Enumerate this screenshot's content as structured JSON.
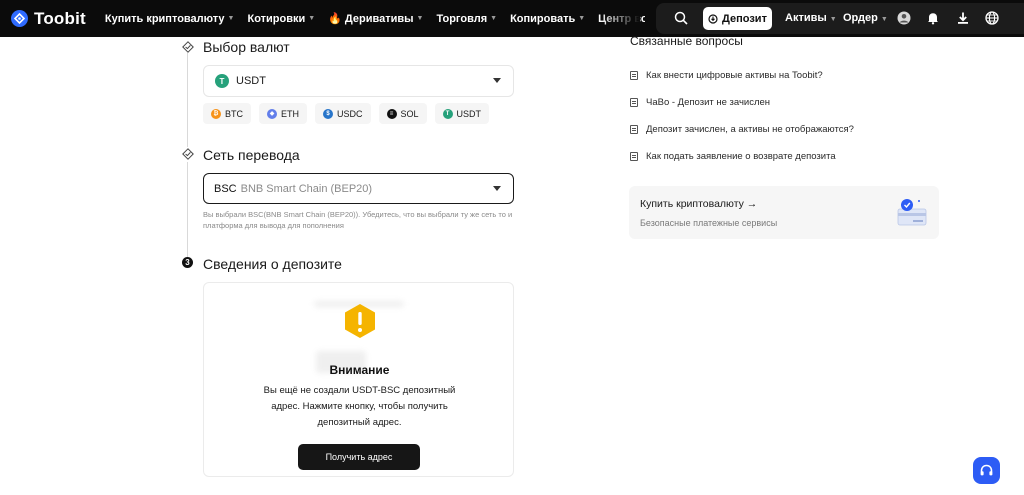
{
  "header": {
    "brand": "Toobit",
    "nav": [
      {
        "label": "Купить криптовалюту",
        "caret": true
      },
      {
        "label": "Котировки",
        "caret": true
      },
      {
        "label": "Деривативы",
        "caret": true,
        "hot": true
      },
      {
        "label": "Торговля",
        "caret": true
      },
      {
        "label": "Копировать",
        "caret": true
      },
      {
        "label": "Центр вознаграждений",
        "caret": false
      }
    ],
    "deposit_label": "Депозит",
    "assets_label": "Активы",
    "orders_label": "Ордер"
  },
  "steps": {
    "currency": {
      "title": "Выбор валют",
      "selected": "USDT",
      "quick_coins": [
        {
          "label": "BTC",
          "color": "#f7931a",
          "glyph": "₿"
        },
        {
          "label": "ETH",
          "color": "#627eea",
          "glyph": "◆"
        },
        {
          "label": "USDC",
          "color": "#2775ca",
          "glyph": "$"
        },
        {
          "label": "SOL",
          "color": "#111111",
          "glyph": "≡"
        },
        {
          "label": "USDT",
          "color": "#26a17b",
          "glyph": "T"
        }
      ]
    },
    "network": {
      "title": "Сеть перевода",
      "code": "BSC",
      "name": "BNB Smart Chain (BEP20)",
      "hint": "Вы выбрали BSC(BNB Smart Chain (BEP20)). Убедитесь, что вы выбрали ту же сеть то и платформа для вывода для пополнения"
    },
    "details": {
      "step_number": "3",
      "title": "Сведения о депозите",
      "warning_title": "Внимание",
      "warning_text": "Вы ещё не создали USDT-BSC депозитный адрес. Нажмите кнопку, чтобы получить депозитный адрес.",
      "button_label": "Получить адрес"
    }
  },
  "related": {
    "title": "Связанные вопросы",
    "items": [
      "Как внести цифровые активы на Toobit?",
      "ЧаВо - Депозит не зачислен",
      "Депозит зачислен, а активы не отображаются?",
      "Как подать заявление о возврате депозита"
    ]
  },
  "promo": {
    "title": "Купить криптовалюту →",
    "subtitle": "Безопасные платежные сервисы"
  },
  "colors": {
    "accent": "#2d5cf5",
    "warning": "#f5b400",
    "header_bg": "#0b0b0b"
  }
}
